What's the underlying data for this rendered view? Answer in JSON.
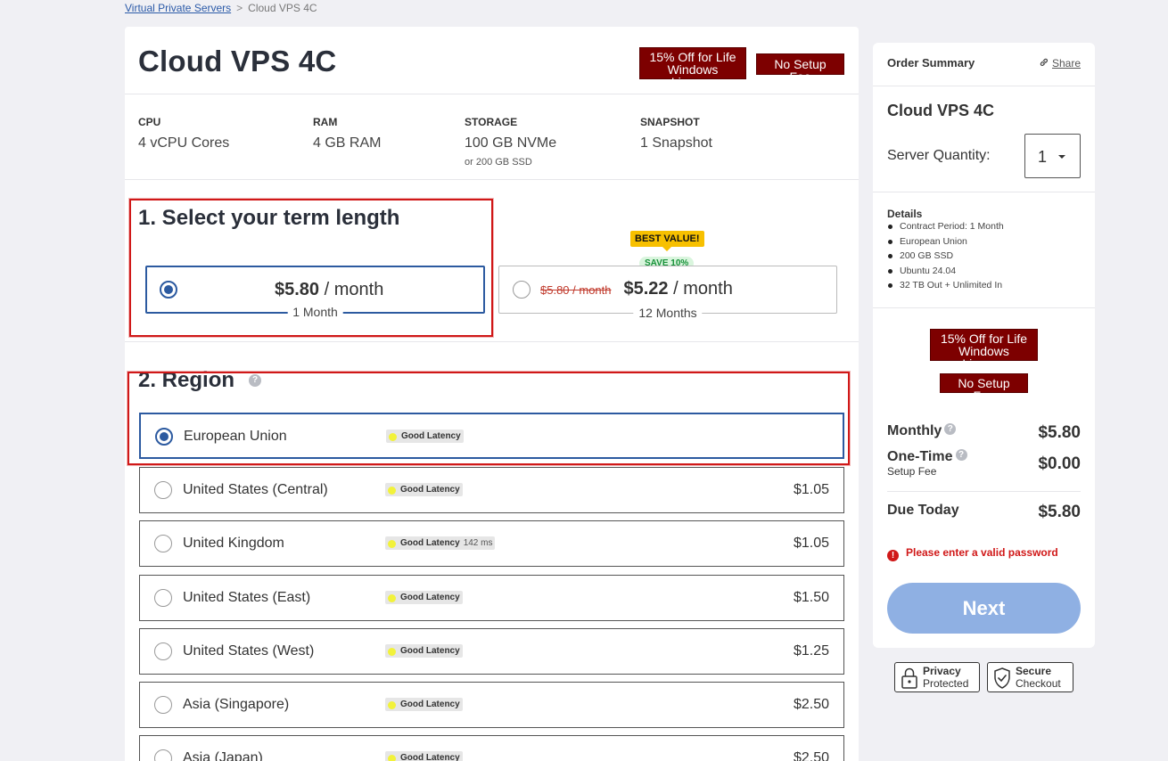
{
  "breadcrumb": {
    "parent": "Virtual Private Servers",
    "separator": ">",
    "current": "Cloud VPS 4C"
  },
  "product": {
    "title": "Cloud VPS 4C",
    "badges": {
      "offer_line1": "15% Off for Life",
      "offer_line2": "Windows License",
      "setup": "No Setup Fee"
    }
  },
  "specs": [
    {
      "label": "CPU",
      "value": "4 vCPU Cores",
      "sub": ""
    },
    {
      "label": "RAM",
      "value": "4 GB RAM",
      "sub": ""
    },
    {
      "label": "STORAGE",
      "value": "100 GB NVMe",
      "sub": "or 200 GB SSD"
    },
    {
      "label": "SNAPSHOT",
      "value": "1 Snapshot",
      "sub": ""
    }
  ],
  "term": {
    "title": "1. Select your term length",
    "options": [
      {
        "price": "$5.80",
        "per": " / month",
        "label": "1 Month",
        "selected": true
      },
      {
        "old_price": "$5.80 / month",
        "price": "$5.22",
        "per": " / month",
        "label": "12 Months",
        "best_value": "BEST VALUE!",
        "save": "SAVE 10%",
        "selected": false
      }
    ]
  },
  "region": {
    "title": "2. Region",
    "help": "?",
    "rows": [
      {
        "name": "European Union",
        "latency": "Good Latency",
        "ms": "",
        "price": "",
        "selected": true
      },
      {
        "name": "United States (Central)",
        "latency": "Good Latency",
        "ms": "",
        "price": "$1.05",
        "selected": false
      },
      {
        "name": "United Kingdom",
        "latency": "Good Latency",
        "ms": "142 ms",
        "price": "$1.05",
        "selected": false
      },
      {
        "name": "United States (East)",
        "latency": "Good Latency",
        "ms": "",
        "price": "$1.50",
        "selected": false
      },
      {
        "name": "United States (West)",
        "latency": "Good Latency",
        "ms": "",
        "price": "$1.25",
        "selected": false
      },
      {
        "name": "Asia (Singapore)",
        "latency": "Good Latency",
        "ms": "",
        "price": "$2.50",
        "selected": false
      },
      {
        "name": "Asia (Japan)",
        "latency": "Good Latency",
        "ms": "",
        "price": "$2.50",
        "selected": false
      }
    ]
  },
  "summary": {
    "title": "Order Summary",
    "share": "Share",
    "product": "Cloud VPS 4C",
    "quantity_label": "Server Quantity:",
    "quantity": "1",
    "details_title": "Details",
    "details": [
      "Contract Period: 1 Month",
      "European Union",
      "200 GB SSD",
      "Ubuntu 24.04",
      "32 TB Out + Unlimited In"
    ],
    "badges": {
      "offer_line1": "15% Off for Life",
      "offer_line2": "Windows License",
      "setup": "No Setup Fee"
    },
    "monthly_label": "Monthly",
    "monthly_value": "$5.80",
    "onetime_label": "One-Time",
    "onetime_sub": "Setup Fee",
    "onetime_value": "$0.00",
    "due_label": "Due Today",
    "due_value": "$5.80",
    "error": "Please enter a valid password",
    "error_icon": "!",
    "next": "Next"
  },
  "trust": {
    "privacy_1": "Privacy",
    "privacy_2": "Protected",
    "secure_1": "Secure",
    "secure_2": "Checkout"
  },
  "colors": {
    "accent": "#2c5aa0",
    "badge": "#7d0000",
    "error": "#d01818",
    "next_button": "#8fb0e3",
    "best_value": "#f7c000"
  }
}
